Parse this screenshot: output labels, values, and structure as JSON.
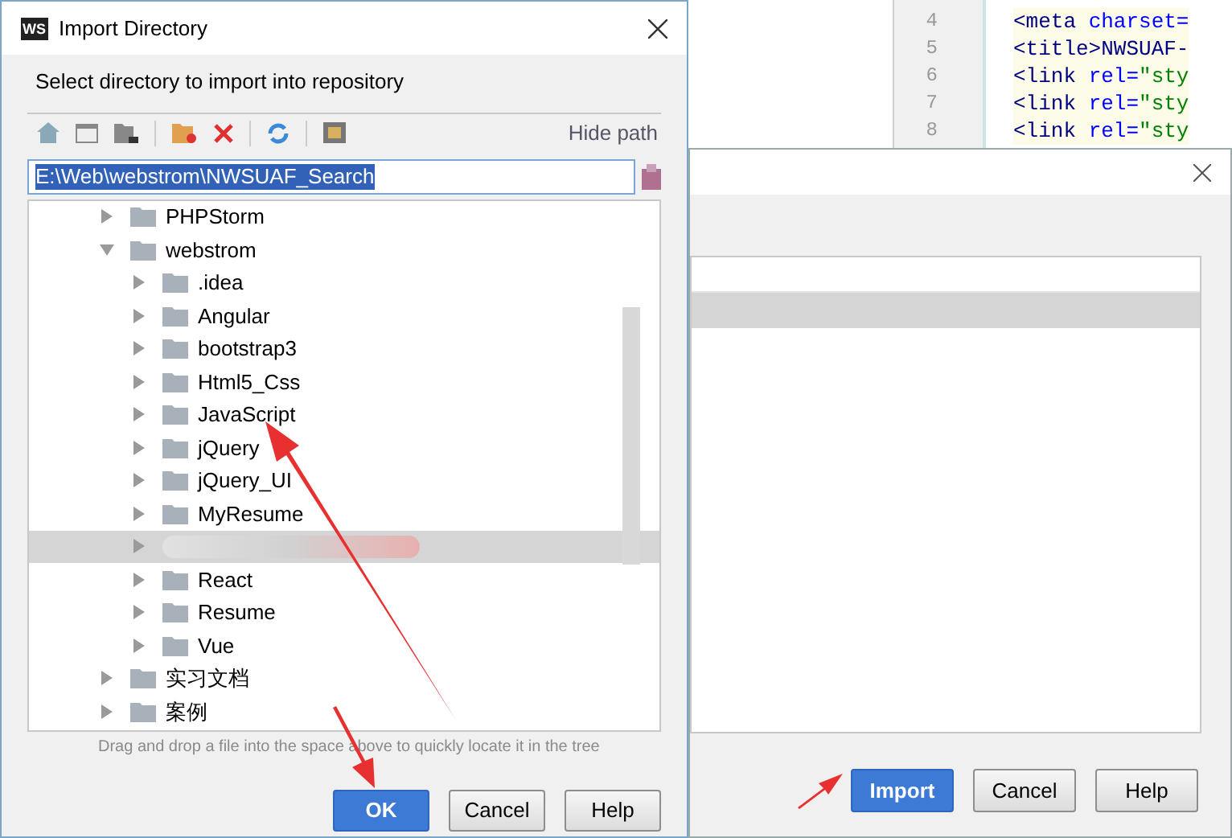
{
  "editor": {
    "lines": [
      {
        "number": "4",
        "parts": [
          {
            "kind": "tag",
            "text": "<meta"
          },
          {
            "kind": "attr",
            "text": " charset="
          }
        ]
      },
      {
        "number": "5",
        "parts": [
          {
            "kind": "tag",
            "text": "<title>NWSUAF-"
          }
        ]
      },
      {
        "number": "6",
        "parts": [
          {
            "kind": "tag",
            "text": "<link"
          },
          {
            "kind": "attr",
            "text": " rel="
          },
          {
            "kind": "string",
            "text": "\"sty"
          }
        ]
      },
      {
        "number": "7",
        "parts": [
          {
            "kind": "tag",
            "text": "<link"
          },
          {
            "kind": "attr",
            "text": " rel="
          },
          {
            "kind": "string",
            "text": "\"sty"
          }
        ]
      },
      {
        "number": "8",
        "parts": [
          {
            "kind": "tag",
            "text": "<link"
          },
          {
            "kind": "attr",
            "text": " rel="
          },
          {
            "kind": "string",
            "text": "\"sty"
          }
        ]
      }
    ]
  },
  "back_dialog": {
    "rows": [
      {
        "selected": false
      },
      {
        "selected": true
      }
    ],
    "buttons": [
      {
        "label": "Import",
        "primary": true
      },
      {
        "label": "Cancel",
        "primary": false
      },
      {
        "label": "Help",
        "primary": false
      }
    ]
  },
  "dialog": {
    "title": "Import Directory",
    "logo": "WS",
    "prompt": "Select directory to import into repository",
    "hide_path": "Hide path",
    "path": "E:\\Web\\webstrom\\NWSUAF_Search",
    "tree": [
      {
        "label": "PHPStorm",
        "expanded": false,
        "selected": false
      },
      {
        "label": "webstrom",
        "expanded": true,
        "selected": false,
        "children": [
          {
            "label": ".idea",
            "expanded": false,
            "selected": false
          },
          {
            "label": "Angular",
            "expanded": false,
            "selected": false
          },
          {
            "label": "bootstrap3",
            "expanded": false,
            "selected": false
          },
          {
            "label": "Html5_Css",
            "expanded": false,
            "selected": false
          },
          {
            "label": "JavaScript",
            "expanded": false,
            "selected": false
          },
          {
            "label": "jQuery",
            "expanded": false,
            "selected": false
          },
          {
            "label": "jQuery_UI",
            "expanded": false,
            "selected": false
          },
          {
            "label": "MyResume",
            "expanded": false,
            "selected": false
          },
          {
            "expanded": false,
            "selected": true
          },
          {
            "label": "React",
            "expanded": false,
            "selected": false
          },
          {
            "label": "Resume",
            "expanded": false,
            "selected": false
          },
          {
            "label": "Vue",
            "expanded": false,
            "selected": false
          }
        ]
      },
      {
        "label": "实习文档",
        "expanded": false,
        "selected": false
      },
      {
        "label": "案例",
        "expanded": false,
        "selected": false
      }
    ],
    "hint": "Drag and drop a file into the space above to quickly locate it in the tree",
    "buttons": [
      {
        "label": "OK",
        "primary": true
      },
      {
        "label": "Cancel",
        "primary": false
      },
      {
        "label": "Help",
        "primary": false
      }
    ]
  }
}
